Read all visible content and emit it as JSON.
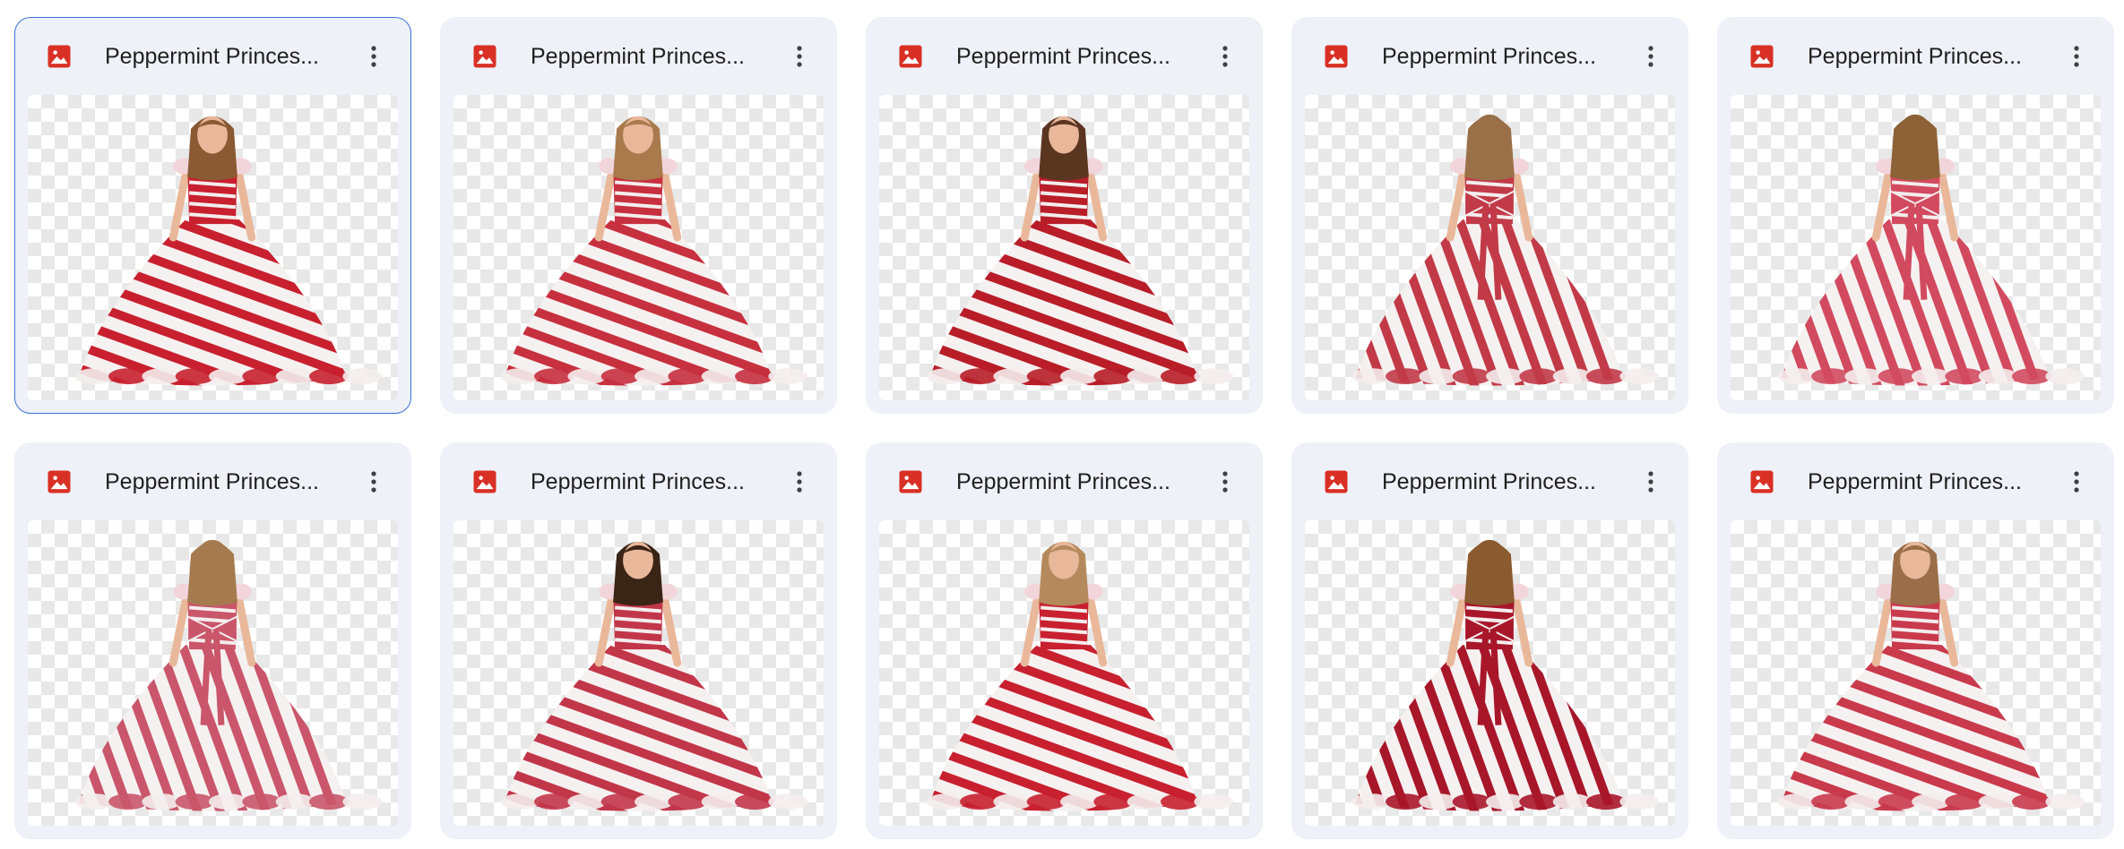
{
  "files": [
    {
      "title": "Peppermint Princes...",
      "type_icon": "image-file-icon",
      "selected": true,
      "view": "front",
      "hair": "#8a5a34",
      "accent": "#c8202f"
    },
    {
      "title": "Peppermint Princes...",
      "type_icon": "image-file-icon",
      "selected": false,
      "view": "front",
      "hair": "#a87a4c",
      "accent": "#c7303e"
    },
    {
      "title": "Peppermint Princes...",
      "type_icon": "image-file-icon",
      "selected": false,
      "view": "front",
      "hair": "#5a3520",
      "accent": "#b81d28"
    },
    {
      "title": "Peppermint Princes...",
      "type_icon": "image-file-icon",
      "selected": false,
      "view": "back",
      "hair": "#9a7048",
      "accent": "#c23a48"
    },
    {
      "title": "Peppermint Princes...",
      "type_icon": "image-file-icon",
      "selected": false,
      "view": "back",
      "hair": "#8d6236",
      "accent": "#d24a5f"
    },
    {
      "title": "Peppermint Princes...",
      "type_icon": "image-file-icon",
      "selected": false,
      "view": "back",
      "hair": "#a47a4e",
      "accent": "#c9566a"
    },
    {
      "title": "Peppermint Princes...",
      "type_icon": "image-file-icon",
      "selected": false,
      "view": "front",
      "hair": "#3a2416",
      "accent": "#c2364a"
    },
    {
      "title": "Peppermint Princes...",
      "type_icon": "image-file-icon",
      "selected": false,
      "view": "front",
      "hair": "#b48a5c",
      "accent": "#c8202f"
    },
    {
      "title": "Peppermint Princes...",
      "type_icon": "image-file-icon",
      "selected": false,
      "view": "back",
      "hair": "#8a5a30",
      "accent": "#a8162a"
    },
    {
      "title": "Peppermint Princes...",
      "type_icon": "image-file-icon",
      "selected": false,
      "view": "front",
      "hair": "#9a6e48",
      "accent": "#c93a4c"
    }
  ],
  "more_icon": "more-vert-icon",
  "colors": {
    "card_bg": "#eef1f7",
    "selected_border": "#3b73d6",
    "file_icon_red": "#d93025"
  }
}
